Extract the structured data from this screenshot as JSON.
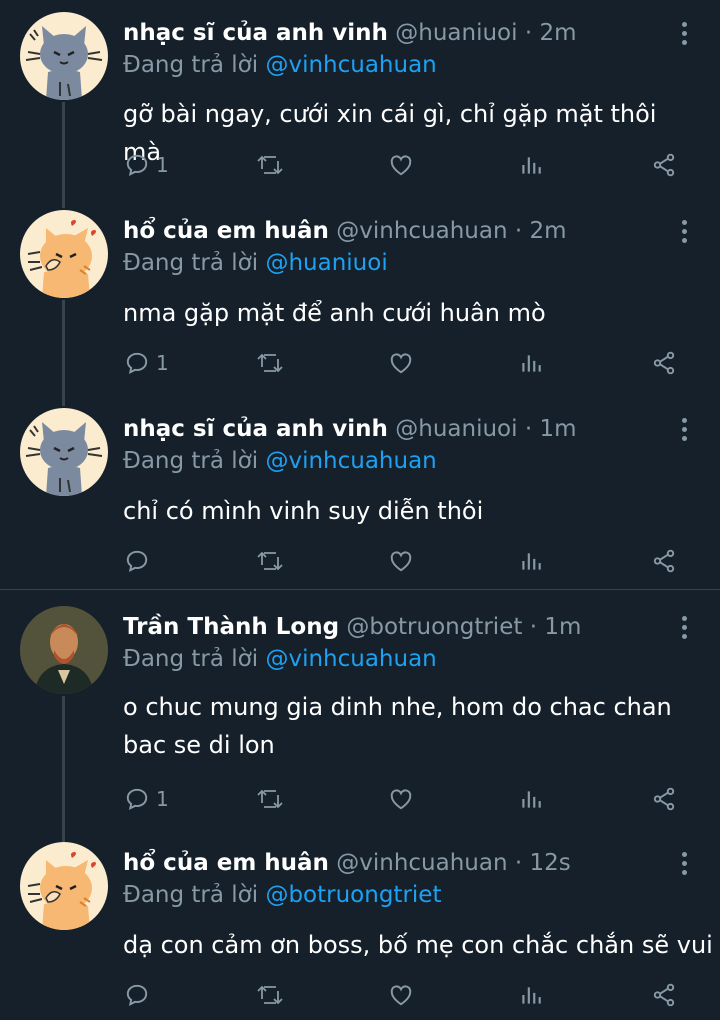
{
  "reply_prefix": "Đang trả lời",
  "colors": {
    "background": "#15202b",
    "text": "#ffffff",
    "muted": "#8899a6",
    "link": "#1da1f2",
    "line": "#38444d"
  },
  "icons": {
    "reply": "reply-icon",
    "retweet": "retweet-icon",
    "like": "heart-icon",
    "analytics": "analytics-icon",
    "share": "share-icon",
    "more": "more-vertical-icon"
  },
  "tweets": [
    {
      "name": "nhạc sĩ của anh vinh",
      "handle": "@huaniuoi",
      "time": "2m",
      "reply_to": "@vinhcuahuan",
      "text": "gỡ bài ngay, cưới xin cái gì, chỉ gặp mặt thôi mà",
      "reply_count": "1",
      "avatar": "gray-cat-avatar"
    },
    {
      "name": "hổ của em huân",
      "handle": "@vinhcuahuan",
      "time": "2m",
      "reply_to": "@huaniuoi",
      "text": "nma gặp mặt để anh cưới huân mò",
      "reply_count": "1",
      "avatar": "orange-cat-avatar"
    },
    {
      "name": "nhạc sĩ của anh vinh",
      "handle": "@huaniuoi",
      "time": "1m",
      "reply_to": "@vinhcuahuan",
      "text": "chỉ có mình vinh suy diễn thôi",
      "reply_count": "",
      "avatar": "gray-cat-avatar"
    },
    {
      "name": "Trần Thành Long",
      "handle": "@botruongtriet",
      "time": "1m",
      "reply_to": "@vinhcuahuan",
      "text": "o chuc mung gia dinh nhe, hom do chac chan bac se di lon",
      "reply_count": "1",
      "avatar": "portrait-avatar"
    },
    {
      "name": "hổ của em huân",
      "handle": "@vinhcuahuan",
      "time": "12s",
      "reply_to": "@botruongtriet",
      "text": "dạ con cảm ơn boss, bố mẹ con chắc chắn sẽ vui",
      "reply_count": "",
      "avatar": "orange-cat-avatar"
    }
  ]
}
